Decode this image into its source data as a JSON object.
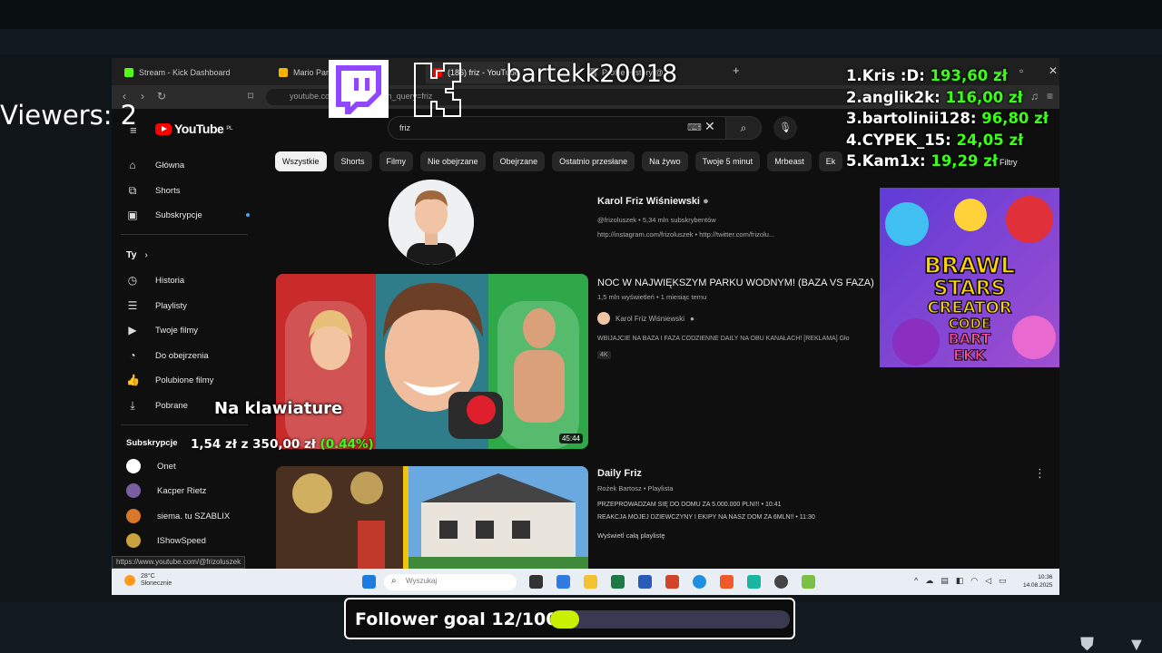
{
  "browser": {
    "tabs": [
      {
        "label": "Stream - Kick Dashboard",
        "color": "#53fc18"
      },
      {
        "label": "Mario Party",
        "color": "#f4b400"
      },
      {
        "label": "(186) friz - YouTube",
        "color": "#ff0000"
      },
      {
        "label": "Profile History @",
        "color": "#888888"
      }
    ],
    "url": "youtube.com/results?search_query=friz"
  },
  "youtube": {
    "logo": "YouTube",
    "country": "PL",
    "search_value": "friz",
    "sidebar": {
      "main": [
        "Główna",
        "Shorts",
        "Subskrypcje"
      ],
      "you_heading": "Ty",
      "you_items": [
        "Historia",
        "Playlisty",
        "Twoje filmy",
        "Do obejrzenia",
        "Polubione filmy",
        "Pobrane"
      ],
      "subs_heading": "Subskrypcje",
      "subscriptions": [
        {
          "name": "Onet",
          "color": "#ffffff"
        },
        {
          "name": "Kacper Rietz",
          "color": "#7a5fa0"
        },
        {
          "name": "siema. tu SZABLIX",
          "color": "#d9772a"
        },
        {
          "name": "IShowSpeed",
          "color": "#c9a23b"
        }
      ]
    },
    "chips": [
      "Wszystkie",
      "Shorts",
      "Filmy",
      "Nie obejrzane",
      "Obejrzane",
      "Ostatnio przesłane",
      "Na żywo",
      "Twoje 5 minut",
      "Mrbeast",
      "Ek"
    ],
    "filters_label": "Filtry",
    "channel": {
      "name": "Karol Friz Wiśniewski",
      "meta": "@frizoluszek • 5,34 mln subskrybentów",
      "links": "http://instagram.com/frizoluszek • http://twitter.com/frizolu..."
    },
    "video1": {
      "title": "NOC W NAJWIĘKSZYM PARKU WODNYM! (BAZA VS FAZA)",
      "meta": "1,5 mln wyświetleń • 1 miesiąc temu",
      "channel": "Karol Friz Wiśniewski",
      "desc": "WBIJAJCIE NA BAZA I FAZA CODZIENNE DAILY NA OBU KANAŁACH! [REKLAMA] Gło",
      "badge": "4K",
      "duration": "45:44"
    },
    "playlist": {
      "title": "Daily Friz",
      "meta": "Rożek Bartosz • Playlista",
      "ep1": "PRZEPROWADZAM SIĘ DO DOMU ZA 5.000.000 PLN!!! • 10:41",
      "ep2": "REAKCJA MOJEJ DZIEWCZYNY I EKIPY NA NASZ DOM ZA 6MLN!! • 11:30",
      "see_all": "Wyświetl całą playlistę"
    },
    "status_url": "https://www.youtube.com/@frizoluszek",
    "ad_text": [
      "BRAWL",
      "STARS",
      "CREATOR",
      "CODE",
      "BART",
      "EKK"
    ]
  },
  "taskbar": {
    "weather_temp": "28°C",
    "weather_desc": "Słonecznie",
    "search_placeholder": "Wyszukaj",
    "time": "10:36",
    "date": "14.08.2025"
  },
  "overlay": {
    "viewers": "Viewers: 2",
    "last_follower": "bartekk20018",
    "leaderboard": [
      {
        "name": "1.Kris :D:",
        "amount": "193,60 zł"
      },
      {
        "name": "2.anglik2k:",
        "amount": "116,00 zł"
      },
      {
        "name": "3.bartolinii128:",
        "amount": "96,80 zł"
      },
      {
        "name": "4.CYPEK_15:",
        "amount": "24,05 zł"
      },
      {
        "name": "5.Kam1x:",
        "amount": "19,29 zł"
      }
    ],
    "keyboard_label": "Na klawiature",
    "donation_goal": {
      "current": "1,54 zł",
      "separator": "z",
      "target": "350,00 zł",
      "percent": "(0.44%)"
    },
    "follower_goal": {
      "label": "Follower goal 12/100",
      "progress": 0.12,
      "fill_color": "#c8f000"
    }
  }
}
